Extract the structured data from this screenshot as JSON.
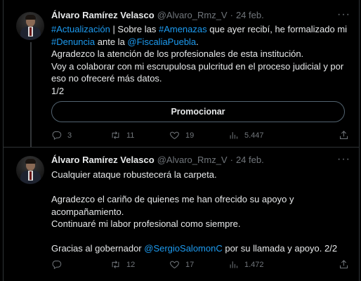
{
  "tweets": [
    {
      "name": "Álvaro Ramírez Velasco",
      "handle": "@Alvaro_Rmz_V",
      "dot": "·",
      "date": "24 feb.",
      "more": "···",
      "line1": {
        "p1": "#Actualización",
        "p2": " | Sobre las ",
        "p3": "#Amenazas",
        "p4": " que ayer recibí, he formalizado mi"
      },
      "line2": {
        "p1": "#Denuncia",
        "p2": " ante la ",
        "p3": "@FiscaliaPuebla",
        "p4": "."
      },
      "line3": "Agradezco la atención de los profesionales de esta institución.",
      "line4": "Voy a colaborar con mi escrupulosa pulcritud en el proceso judicial y por",
      "line5": "eso no ofreceré más datos.",
      "line6": "1/2",
      "promote_label": "Promocionar",
      "replies": "3",
      "retweets": "11",
      "likes": "19",
      "views": "5.447"
    },
    {
      "name": "Álvaro Ramírez Velasco",
      "handle": "@Alvaro_Rmz_V",
      "dot": "·",
      "date": "24 feb.",
      "more": "···",
      "line1": "Cualquier ataque robustecerá la carpeta.",
      "line2": "Agradezco el cariño de quienes me han ofrecido su apoyo y",
      "line3": "acompañamiento.",
      "line4": "Continuaré mi labor profesional como siempre.",
      "line5": {
        "p1": "Gracias al gobernador ",
        "p2": "@SergioSalomonC",
        "p3": " por su llamada y apoyo. 2/2"
      },
      "replies": "",
      "retweets": "12",
      "likes": "17",
      "views": "1.472"
    }
  ],
  "icons": {
    "reply": "reply-icon",
    "retweet": "retweet-icon",
    "like": "heart-icon",
    "views": "views-icon",
    "share": "share-icon"
  },
  "colors": {
    "background": "#000000",
    "text": "#e7e9ea",
    "muted": "#71767b",
    "link": "#1d9bf0",
    "border": "#2f3336"
  }
}
